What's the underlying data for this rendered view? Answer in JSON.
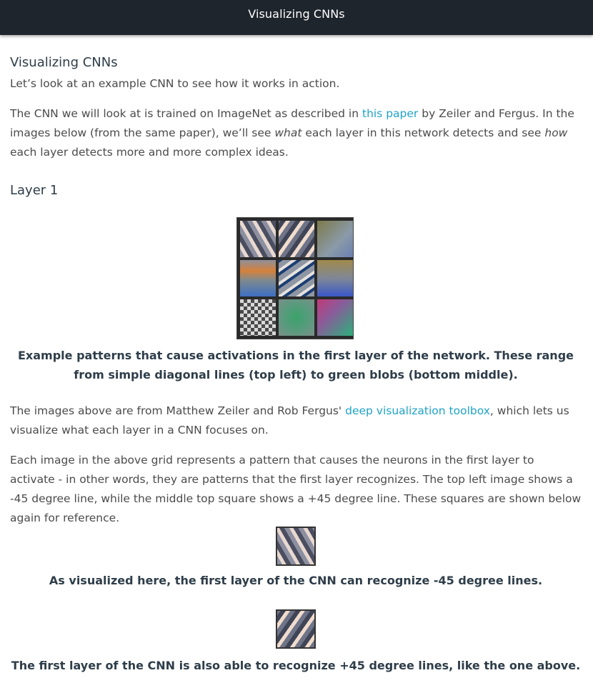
{
  "header": {
    "title": "Visualizing CNNs"
  },
  "section_title": "Visualizing CNNs",
  "intro": "Let’s look at an example CNN to see how it works in action.",
  "para1": {
    "before_link": "The CNN we will look at is trained on ImageNet as described in ",
    "link": "this paper",
    "after_link": " by Zeiler and Fergus. In the images below (from the same paper), we’ll see ",
    "em1": "what",
    "mid": " each layer in this network detects and see ",
    "em2": "how",
    "end": " each layer detects more and more complex ideas."
  },
  "layer_heading": "Layer 1",
  "grid_caption": "Example patterns that cause activations in the first layer of the network. These range from simple diagonal lines (top left) to green blobs (bottom middle).",
  "para2": {
    "before_link": "The images above are from Matthew Zeiler and Rob Fergus' ",
    "link": "deep visualization toolbox",
    "after_link": ", which lets us visualize what each layer in a CNN focuses on."
  },
  "para3": "Each image in the above grid represents a pattern that causes the neurons in the first layer to activate - in other words, they are patterns that the first layer recognizes. The top left image shows a -45 degree line, while the middle top square shows a +45 degree line. These squares are shown below again for reference.",
  "caption_neg45": "As visualized here, the first layer of the CNN can recognize -45 degree lines.",
  "caption_pos45": "The first layer of the CNN is also able to recognize +45 degree lines, like the one above.",
  "colors": {
    "header_bg": "#1f252c",
    "link": "#1fa3c8",
    "heading": "#2e3d49",
    "body_text": "#4b4b4b"
  }
}
